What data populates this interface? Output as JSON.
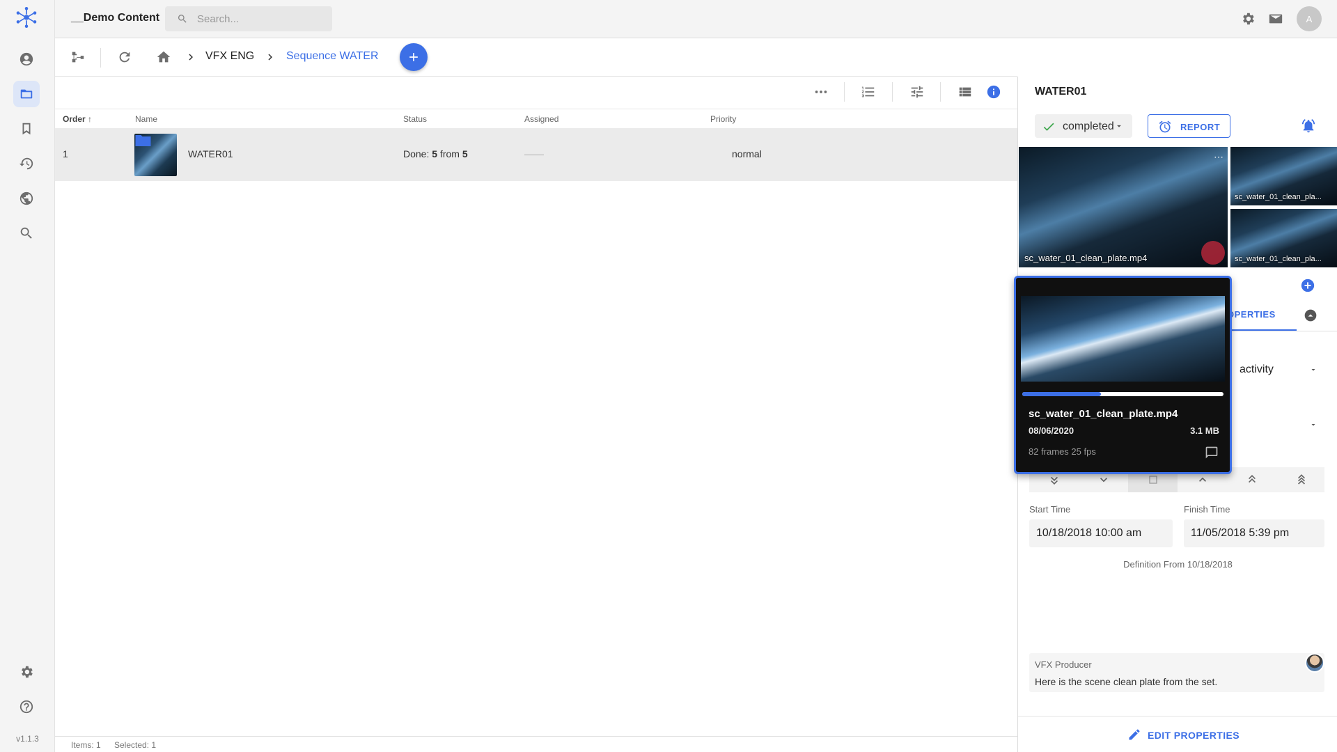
{
  "app": {
    "version": "v1.1.3"
  },
  "topbar": {
    "workspace": "__Demo Content",
    "search_placeholder": "Search...",
    "avatar_initial": "A"
  },
  "breadcrumb": {
    "items": [
      "VFX ENG",
      "Sequence WATER"
    ]
  },
  "table": {
    "columns": [
      "Order",
      "Name",
      "Status",
      "Assigned",
      "Priority"
    ],
    "rows": [
      {
        "order": "1",
        "name": "WATER01",
        "status_prefix": "Done: ",
        "done": "5",
        "status_mid": " from ",
        "total": "5",
        "assigned": "——",
        "priority": "normal"
      }
    ]
  },
  "statusbar": {
    "items": "Items: 1",
    "selected": "Selected: 1"
  },
  "panel": {
    "title": "WATER01",
    "status": "completed",
    "report_label": "REPORT",
    "media": [
      {
        "caption": "sc_water_01_clean_plate.mp4"
      },
      {
        "caption": "sc_water_01_clean_pla..."
      },
      {
        "caption": "sc_water_01_clean_pla..."
      }
    ],
    "tab_properties": "OPERTIES",
    "activity_value": "activity",
    "start_label": "Start Time",
    "start_value": "10/18/2018 10:00 am",
    "finish_label": "Finish Time",
    "finish_value": "11/05/2018 5:39 pm",
    "definition": "Definition From 10/18/2018",
    "comment_author": "VFX Producer",
    "comment_text": "Here is the scene clean plate from the set.",
    "edit_label": "EDIT PROPERTIES"
  },
  "hovercard": {
    "filename": "sc_water_01_clean_plate.mp4",
    "date": "08/06/2020",
    "size": "3.1 MB",
    "frames": "82 frames 25 fps",
    "progress": 0.39
  },
  "colors": {
    "accent": "#3c6fe6",
    "success": "#3aa54a",
    "row_selected": "#ebebeb"
  }
}
